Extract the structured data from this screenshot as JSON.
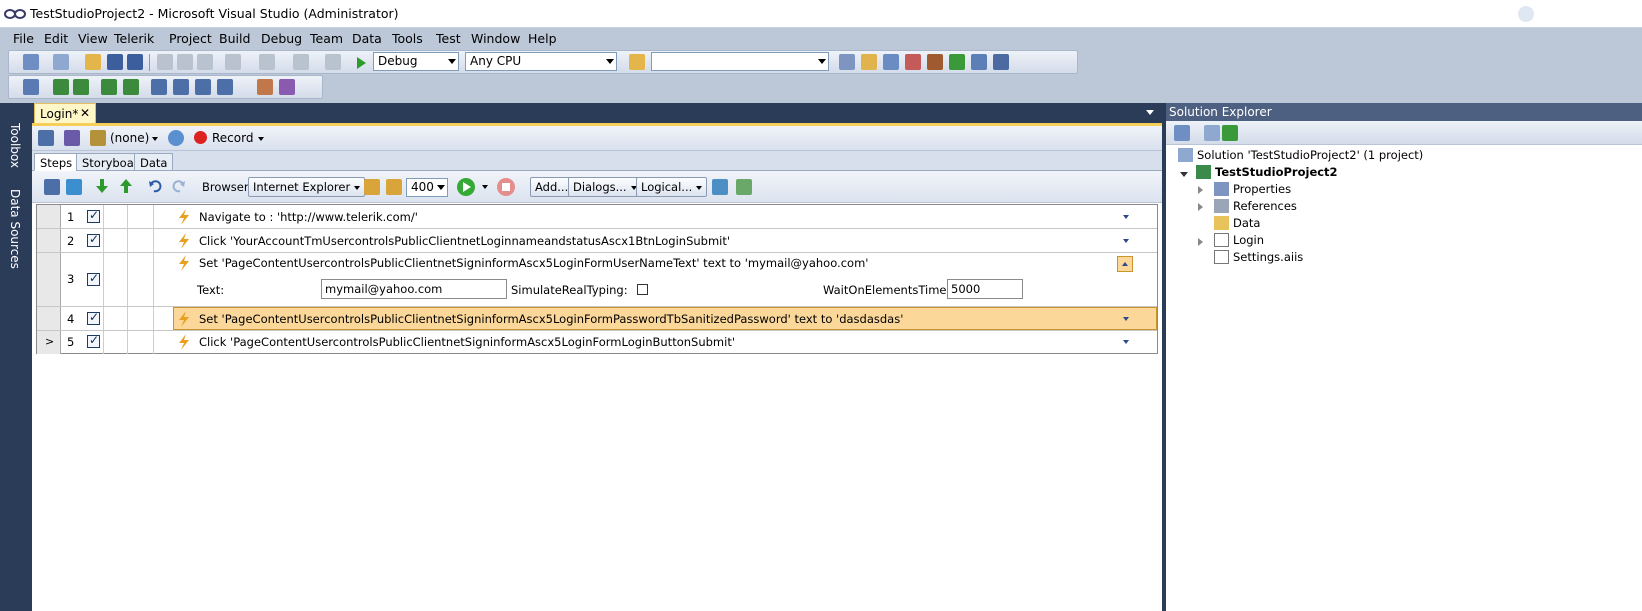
{
  "window": {
    "title": "TestStudioProject2 - Microsoft Visual Studio (Administrator)"
  },
  "menu": [
    "File",
    "Edit",
    "View",
    "Telerik",
    "Project",
    "Build",
    "Debug",
    "Team",
    "Data",
    "Tools",
    "Test",
    "Window",
    "Help"
  ],
  "toolbar": {
    "config": "Debug",
    "platform": "Any CPU",
    "find": ""
  },
  "side_tabs": {
    "toolbox": "Toolbox",
    "datasources": "Data Sources"
  },
  "document_tab": {
    "label": "Login*",
    "close": "✕"
  },
  "editor": {
    "target": "(none)",
    "record": "Record",
    "tabs": [
      "Steps",
      "Storyboard",
      "Data"
    ],
    "browser_label": "Browser:",
    "browser": "Internet Explorer",
    "delay": "400",
    "add": "Add...",
    "dialogs": "Dialogs...",
    "logical": "Logical..."
  },
  "steps": [
    {
      "num": "1",
      "desc": "Navigate to : 'http://www.telerik.com/'"
    },
    {
      "num": "2",
      "desc": "Click 'YourAccountTmUsercontrolsPublicClientnetLoginnameandstatusAscx1BtnLoginSubmit'"
    },
    {
      "num": "3",
      "desc": "Set 'PageContentUsercontrolsPublicClientnetSigninformAscx5LoginFormUserNameText' text to 'mymail@yahoo.com'"
    },
    {
      "num": "4",
      "desc": "Set 'PageContentUsercontrolsPublicClientnetSigninformAscx5LoginFormPasswordTbSanitizedPassword' text to 'dasdasdas'"
    },
    {
      "num": "5",
      "desc": "Click 'PageContentUsercontrolsPublicClientnetSigninformAscx5LoginFormLoginButtonSubmit'"
    }
  ],
  "step3_props": {
    "text_label": "Text:",
    "text_value": "mymail@yahoo.com",
    "simulate_label": "SimulateRealTyping:",
    "timeout_label": "WaitOnElementsTimeout:",
    "timeout_value": "5000"
  },
  "row5_marker": ">",
  "solution_explorer": {
    "title": "Solution Explorer",
    "solution": "Solution 'TestStudioProject2' (1 project)",
    "project": "TestStudioProject2",
    "items": [
      "Properties",
      "References",
      "Data",
      "Login",
      "Settings.aiis"
    ]
  }
}
